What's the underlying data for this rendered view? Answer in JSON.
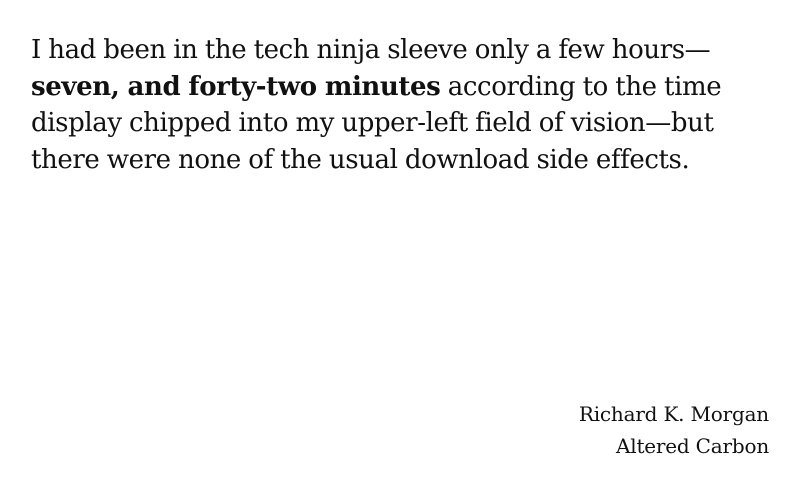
{
  "quote": {
    "before_bold": "I had been in the tech ninja sleeve only a few hours—",
    "bold": "seven, and forty-two minutes",
    "after_bold": " according to the time display chipped into my upper-left field of vision—but there were none of the usual download side effects."
  },
  "attribution": {
    "author": "Richard K. Morgan",
    "source": "Altered Carbon"
  }
}
